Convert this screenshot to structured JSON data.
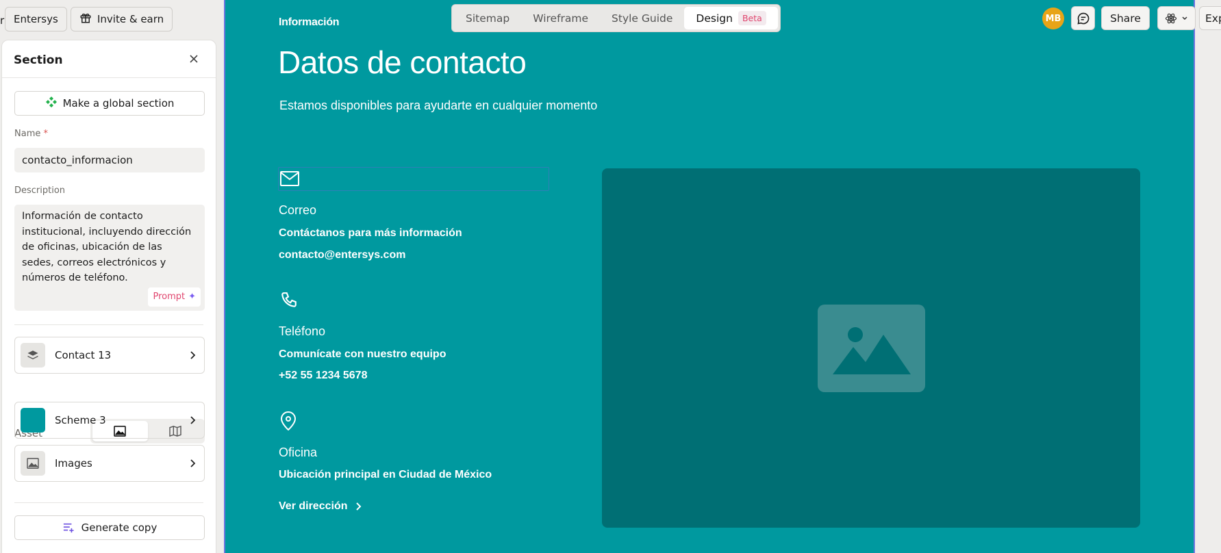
{
  "topbar": {
    "left_cut_text": "r",
    "workspace_label": "Entersys",
    "invite_label": "Invite & earn"
  },
  "panel": {
    "title": "Section",
    "global_section_label": "Make a global section",
    "name_label": "Name",
    "name_required_mark": "*",
    "name_value": "contacto_informacion",
    "description_label": "Description",
    "description_value": "Información de contacto institucional, incluyendo dirección de oficinas, ubicación de las sedes, correos electrónicos y números de teléfono.",
    "prompt_label": "Prompt",
    "prompt_glyph": "✦",
    "layout_row_label": "Contact 13",
    "asset_label": "Asset",
    "scheme_row_label": "Scheme 3",
    "scheme_color": "#00999f",
    "images_row_label": "Images",
    "generate_label": "Generate copy"
  },
  "view_toggle": {
    "tabs": [
      "Sitemap",
      "Wireframe",
      "Style Guide",
      "Design"
    ],
    "active": "Design",
    "beta_badge": "Beta"
  },
  "toolbar_right": {
    "avatar_initials": "MB",
    "share_label": "Share",
    "export_label": "Exp"
  },
  "canvas": {
    "background": "#00999f",
    "eyebrow": "Información",
    "heading": "Datos de contacto",
    "subheading": "Estamos disponibles para ayudarte en cualquier momento",
    "items": [
      {
        "icon": "mail-icon",
        "title": "Correo",
        "desc": "Contáctanos para más información",
        "value": "contacto@entersys.com"
      },
      {
        "icon": "phone-icon",
        "title": "Teléfono",
        "desc": "Comunícate con nuestro equipo",
        "value": "+52 55 1234 5678"
      },
      {
        "icon": "map-pin-icon",
        "title": "Oficina",
        "desc": "Ubicación principal en Ciudad de México",
        "link": "Ver dirección"
      }
    ]
  }
}
